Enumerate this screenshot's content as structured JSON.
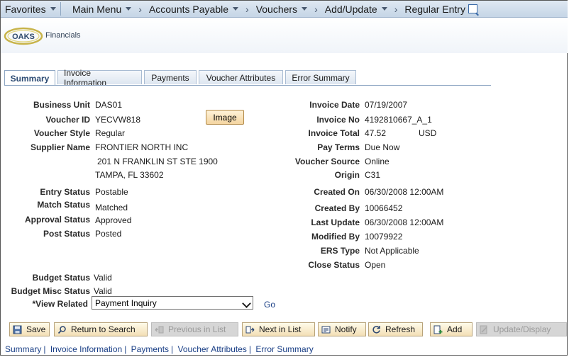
{
  "nav": {
    "favorites": "Favorites",
    "crumbs": [
      "Main Menu",
      "Accounts Payable",
      "Vouchers",
      "Add/Update",
      "Regular Entry"
    ]
  },
  "brand": {
    "logo": "OAKS",
    "product": "Financials"
  },
  "tabs": [
    "Summary",
    "Invoice Information",
    "Payments",
    "Voucher Attributes",
    "Error Summary"
  ],
  "left": {
    "business_unit": {
      "label": "Business Unit",
      "value": "DAS01"
    },
    "voucher_id": {
      "label": "Voucher ID",
      "value": "YECVW818"
    },
    "voucher_style": {
      "label": "Voucher Style",
      "value": "Regular"
    },
    "supplier_name": {
      "label": "Supplier Name",
      "value": "FRONTIER NORTH INC"
    },
    "address1": "201 N FRANKLIN ST STE 1900",
    "address2": "TAMPA, FL  33602",
    "entry_status": {
      "label": "Entry Status",
      "value": "Postable"
    },
    "match_status": {
      "label": "Match Status",
      "value": "Matched"
    },
    "approval_status": {
      "label": "Approval Status",
      "value": "Approved"
    },
    "post_status": {
      "label": "Post Status",
      "value": "Posted"
    },
    "budget_status": {
      "label": "Budget Status",
      "value": "Valid"
    },
    "budget_misc_status": {
      "label": "Budget Misc Status",
      "value": "Valid"
    },
    "view_related": {
      "label": "*View Related",
      "value": "Payment Inquiry",
      "go": "Go"
    }
  },
  "image_button": "Image",
  "right": {
    "invoice_date": {
      "label": "Invoice Date",
      "value": "07/19/2007"
    },
    "invoice_no": {
      "label": "Invoice No",
      "value": "4192810667_A_1"
    },
    "invoice_total": {
      "label": "Invoice Total",
      "value": "47.52",
      "currency": "USD"
    },
    "pay_terms": {
      "label": "Pay Terms",
      "value": "Due Now"
    },
    "voucher_source": {
      "label": "Voucher Source",
      "value": "Online"
    },
    "origin": {
      "label": "Origin",
      "value": "C31"
    },
    "created_on": {
      "label": "Created On",
      "value": "06/30/2008 12:00AM"
    },
    "created_by": {
      "label": "Created By",
      "value": "10066452"
    },
    "last_update": {
      "label": "Last Update",
      "value": "06/30/2008 12:00AM"
    },
    "modified_by": {
      "label": "Modified By",
      "value": "10079922"
    },
    "ers_type": {
      "label": "ERS Type",
      "value": "Not Applicable"
    },
    "close_status": {
      "label": "Close Status",
      "value": "Open"
    }
  },
  "toolbar": {
    "save": "Save",
    "return_to_search": "Return to Search",
    "previous_in_list": "Previous in List",
    "next_in_list": "Next in List",
    "notify": "Notify",
    "refresh": "Refresh",
    "add": "Add",
    "update_display": "Update/Display"
  },
  "footer_links": [
    "Summary",
    "Invoice Information",
    "Payments",
    "Voucher Attributes",
    "Error Summary"
  ],
  "colors": {
    "link": "#1a3f86",
    "nav_bg": "#c5d5e6",
    "button_bg": "#f3dfb6",
    "active_tab_text": "#2b4a72"
  }
}
